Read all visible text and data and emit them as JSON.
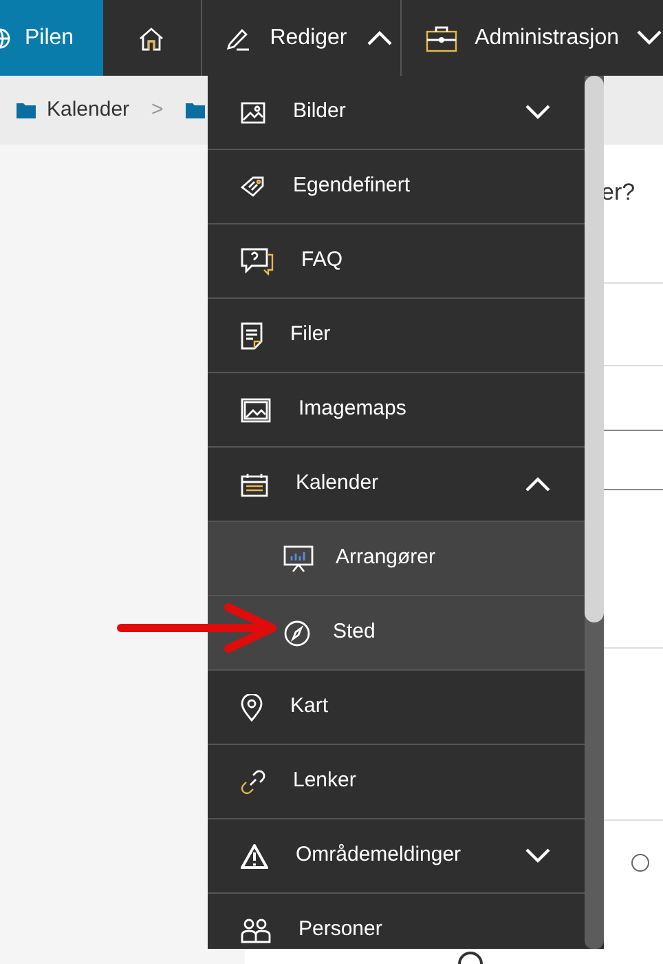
{
  "nav": [
    {
      "label": "Pilen",
      "selected": true
    },
    {
      "selected": false
    },
    {
      "label": "Rediger",
      "selected": false,
      "expanded": true
    },
    {
      "label": "Administrasjon",
      "selected": false,
      "expanded": false
    }
  ],
  "breadcrumb": {
    "items": [
      "Kalender"
    ],
    "separator": ">"
  },
  "content": {
    "question_fragment": "er?",
    "radio": {
      "selected": false
    }
  },
  "menu": [
    {
      "label": "Bilder",
      "expanded": false
    },
    {
      "label": "Egendefinert"
    },
    {
      "label": "FAQ"
    },
    {
      "label": "Filer"
    },
    {
      "label": "Imagemaps"
    },
    {
      "label": "Kalender",
      "expanded": true,
      "children": [
        {
          "label": "Arrangører"
        },
        {
          "label": "Sted"
        }
      ]
    },
    {
      "label": "Kart"
    },
    {
      "label": "Lenker"
    },
    {
      "label": "Områdemeldinger",
      "expanded": false
    },
    {
      "label": "Personer"
    }
  ]
}
